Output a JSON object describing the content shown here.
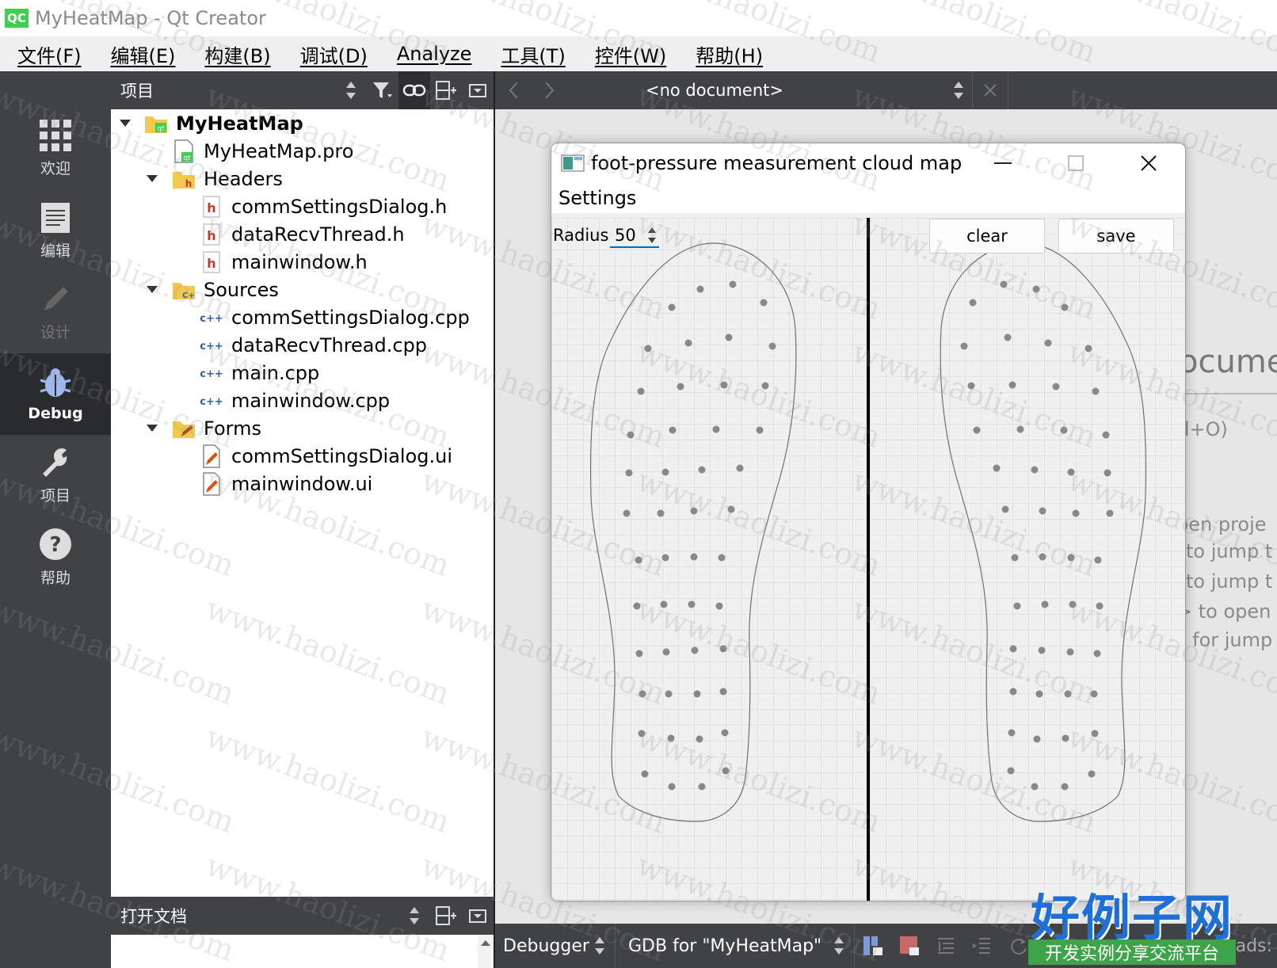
{
  "window": {
    "title": "MyHeatMap - Qt Creator",
    "logo": "QC"
  },
  "menubar": [
    {
      "label": "文件(F)"
    },
    {
      "label": "编辑(E)"
    },
    {
      "label": "构建(B)"
    },
    {
      "label": "调试(D)"
    },
    {
      "label": "Analyze"
    },
    {
      "label": "工具(T)"
    },
    {
      "label": "控件(W)"
    },
    {
      "label": "帮助(H)"
    }
  ],
  "modes": [
    {
      "label": "欢迎",
      "icon": "grid-icon"
    },
    {
      "label": "编辑",
      "icon": "edit-icon"
    },
    {
      "label": "设计",
      "icon": "pencil-icon"
    },
    {
      "label": "Debug",
      "icon": "bug-icon"
    },
    {
      "label": "项目",
      "icon": "wrench-icon"
    },
    {
      "label": "帮助",
      "icon": "help-icon"
    }
  ],
  "project_panel": {
    "title": "项目",
    "tree": [
      {
        "label": "MyHeatMap",
        "icon": "project-folder-icon"
      },
      {
        "label": "MyHeatMap.pro",
        "icon": "pro-file-icon"
      },
      {
        "label": "Headers",
        "icon": "headers-folder-icon"
      },
      {
        "label": "commSettingsDialog.h",
        "icon": "header-file-icon"
      },
      {
        "label": "dataRecvThread.h",
        "icon": "header-file-icon"
      },
      {
        "label": "mainwindow.h",
        "icon": "header-file-icon"
      },
      {
        "label": "Sources",
        "icon": "sources-folder-icon"
      },
      {
        "label": "commSettingsDialog.cpp",
        "icon": "cpp-file-icon"
      },
      {
        "label": "dataRecvThread.cpp",
        "icon": "cpp-file-icon"
      },
      {
        "label": "main.cpp",
        "icon": "cpp-file-icon"
      },
      {
        "label": "mainwindow.cpp",
        "icon": "cpp-file-icon"
      },
      {
        "label": "Forms",
        "icon": "forms-folder-icon"
      },
      {
        "label": "commSettingsDialog.ui",
        "icon": "ui-file-icon"
      },
      {
        "label": "mainwindow.ui",
        "icon": "ui-file-icon"
      }
    ]
  },
  "open_documents": {
    "title": "打开文档"
  },
  "editor": {
    "document_selector": "<no document>",
    "welcome_lines": [
      "ocume",
      "rl+O)",
      "pen proje",
      "to jump t",
      "to jump t",
      "> to open",
      "s for jump"
    ]
  },
  "debug_bar": {
    "debugger": "Debugger",
    "engine": "GDB for \"MyHeatMap\"",
    "threads": "eads:"
  },
  "dialog": {
    "title": "foot-pressure measurement cloud map",
    "menu": "Settings",
    "radius_label": "Radius",
    "radius_value": "50",
    "clear_label": "clear",
    "save_label": "save"
  },
  "watermark": "www.haolizi.com",
  "brand": {
    "main": "好例子网",
    "sub": "开发实例分享交流平台"
  }
}
